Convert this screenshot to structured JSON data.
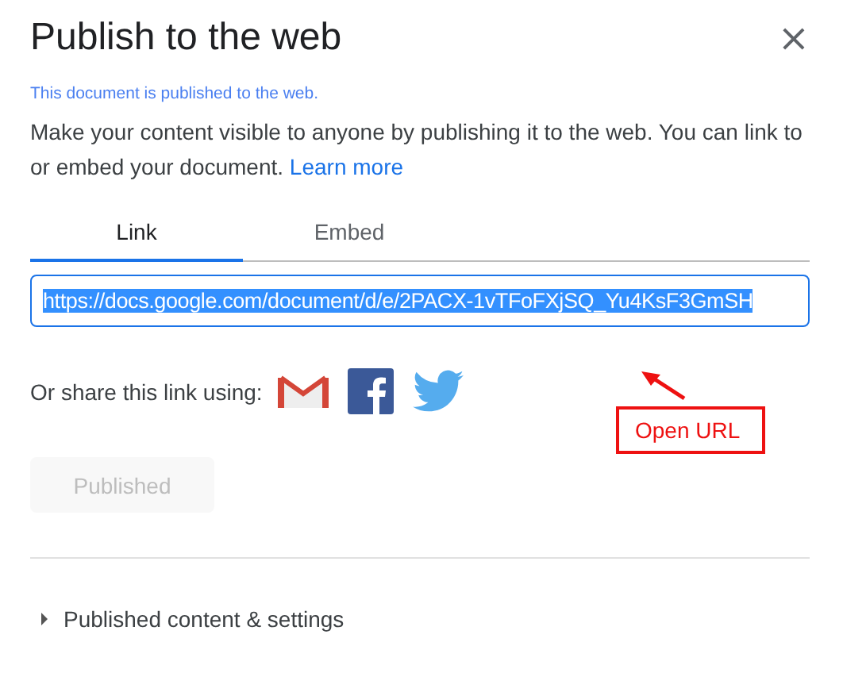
{
  "dialog": {
    "title": "Publish to the web",
    "close": "×"
  },
  "status": "This document is published to the web.",
  "description": {
    "text": "Make your content visible to anyone by publishing it to the web. You can link to or embed your document.",
    "link": "Learn more"
  },
  "tabs": [
    {
      "label": "Link",
      "selected": true
    },
    {
      "label": "Embed",
      "selected": false
    }
  ],
  "link_field": {
    "value": "https://docs.google.com/document/d/e/2PACX-1vTFoFXjSQ_Yu4KsF3GmSH",
    "highlighted": true
  },
  "share": {
    "label": "Or share this link using:",
    "services": [
      {
        "kind": "gmail"
      },
      {
        "kind": "facebook"
      },
      {
        "kind": "twitter"
      }
    ]
  },
  "annotation": {
    "text": "Open URL"
  },
  "publish_button": {
    "label": "Published",
    "disabled": true
  },
  "settings": {
    "label": "Published content & settings",
    "expanded": false
  }
}
